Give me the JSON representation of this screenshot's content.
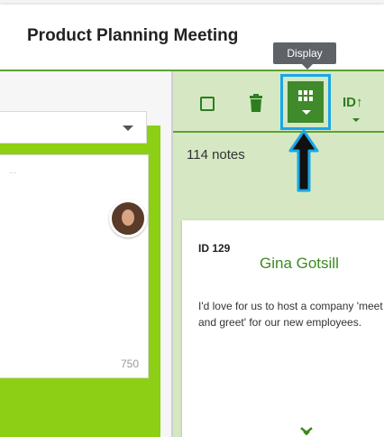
{
  "header": {
    "title": "Product Planning Meeting"
  },
  "left_pane": {
    "textarea_placeholder": "...",
    "char_count": "750"
  },
  "toolbar": {
    "select_all_icon": "checkbox-icon",
    "delete_icon": "trash-icon",
    "display_icon": "grid-icon",
    "sort_label": "ID↑",
    "tooltip": "Display"
  },
  "notes": {
    "count_label": "114 notes",
    "card": {
      "id_label": "ID 129",
      "author": "Gina Gotsill",
      "text": "I'd love for us to host a company 'meet and greet' for our new employees."
    }
  },
  "colors": {
    "accent_green": "#3f8a2a",
    "lime": "#8ccf14",
    "highlight_blue": "#1aa7e6",
    "pane_green": "#d5e8c3"
  }
}
